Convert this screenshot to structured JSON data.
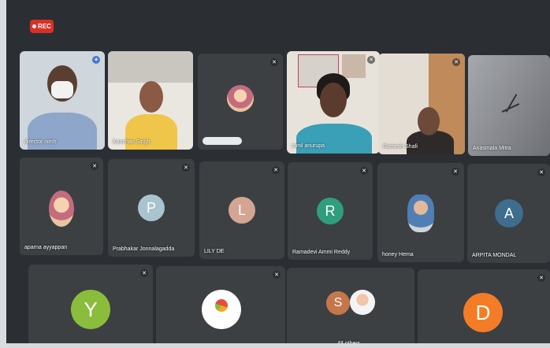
{
  "recording": {
    "label": "REC"
  },
  "row1": [
    {
      "name": "director nimh"
    },
    {
      "name": "Kanchan Singh"
    },
    {
      "name": ""
    },
    {
      "name": "sunil anurupa"
    },
    {
      "name": "Ramesh Shafi"
    },
    {
      "name": "Anasmala Mitra"
    }
  ],
  "row2": [
    {
      "name": "aparna ayyappan",
      "type": "photo"
    },
    {
      "name": "Prabhakar Jonnalagadda",
      "initial": "P",
      "color": "#a9c4cf"
    },
    {
      "name": "LILY DE",
      "initial": "L",
      "color": "#d3a592"
    },
    {
      "name": "Ramadevi Ammi Reddy",
      "initial": "R",
      "color": "#2f9e7d"
    },
    {
      "name": "honey Hema",
      "type": "photo"
    },
    {
      "name": "ARPITA MONDAL",
      "initial": "A",
      "color": "#3e6d8e"
    }
  ],
  "row3": [
    {
      "initial": "Y",
      "color": "#8bbd3c"
    },
    {
      "type": "logo"
    },
    {
      "name": "48 others",
      "initial": "S",
      "color": "#c5774b"
    },
    {
      "initial": "D",
      "color": "#f47c27"
    }
  ],
  "colors": {
    "rec": "#d93025",
    "tile": "#3c4043",
    "background": "#2b2f33"
  },
  "icons": [
    "record-dot-icon",
    "mic-muted-icon",
    "pin-icon"
  ]
}
